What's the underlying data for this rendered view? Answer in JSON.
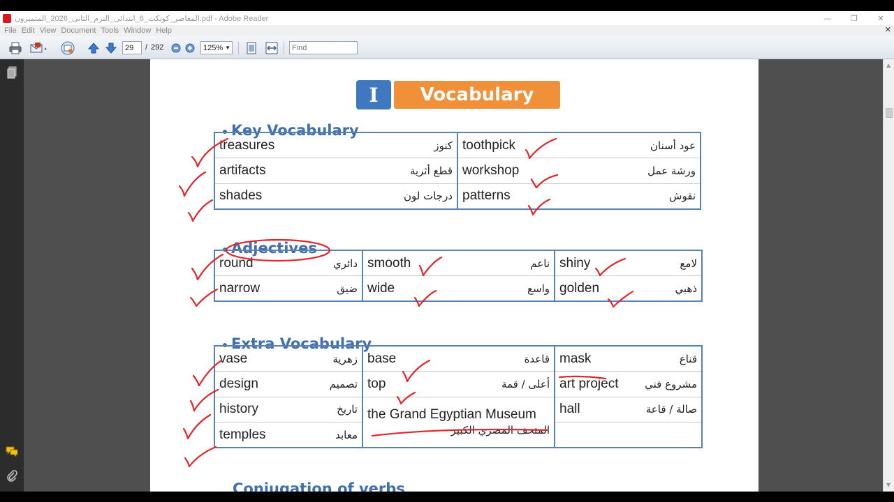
{
  "window": {
    "title": "المعاصر_كونكت_6_ابتدائى_الترم_الثانى_2026_المتميزون.pdf - Adobe Reader",
    "controls": {
      "minimize": "—",
      "maximize": "❐",
      "close": "✕"
    }
  },
  "menu": [
    "File",
    "Edit",
    "View",
    "Document",
    "Tools",
    "Window",
    "Help"
  ],
  "menu_close": "✕",
  "toolbar": {
    "current_page": "29",
    "page_separator": "/",
    "total_pages": "292",
    "zoom": "125%",
    "find_placeholder": "Find"
  },
  "page": {
    "section_number": "I",
    "section_title": "Vocabulary",
    "key_vocabulary": {
      "title": "Key Vocabulary",
      "rows": [
        [
          {
            "en": "treasures",
            "ar": "كنوز"
          },
          {
            "en": "toothpick",
            "ar": "عود أسنان"
          }
        ],
        [
          {
            "en": "artifacts",
            "ar": "قطع أثرية"
          },
          {
            "en": "workshop",
            "ar": "ورشة عمل"
          }
        ],
        [
          {
            "en": "shades",
            "ar": "درجات لون"
          },
          {
            "en": "patterns",
            "ar": "نقوش"
          }
        ]
      ]
    },
    "adjectives": {
      "title": "Adjectives",
      "rows": [
        [
          {
            "en": "round",
            "ar": "دائري"
          },
          {
            "en": "smooth",
            "ar": "ناعم"
          },
          {
            "en": "shiny",
            "ar": "لامع"
          }
        ],
        [
          {
            "en": "narrow",
            "ar": "ضيق"
          },
          {
            "en": "wide",
            "ar": "واسع"
          },
          {
            "en": "golden",
            "ar": "ذهبي"
          }
        ]
      ]
    },
    "extra_vocabulary": {
      "title": "Extra Vocabulary",
      "rows": [
        [
          {
            "en": "vase",
            "ar": "زهرية"
          },
          {
            "en": "base",
            "ar": "قاعدة"
          },
          {
            "en": "mask",
            "ar": "قناع"
          }
        ],
        [
          {
            "en": "design",
            "ar": "تصميم"
          },
          {
            "en": "top",
            "ar": "أعلى / قمة"
          },
          {
            "en": "art project",
            "ar": "مشروع فني"
          }
        ],
        [
          {
            "en": "history",
            "ar": "تاريخ"
          },
          {
            "en": "the Grand Egyptian Museum",
            "ar": "المتحف المصري الكبير"
          },
          {
            "en": "hall",
            "ar": "صالة / قاعة"
          }
        ],
        [
          {
            "en": "temples",
            "ar": "معابد"
          },
          null,
          {
            "en": "",
            "ar": ""
          }
        ]
      ]
    },
    "next_section_title": "Conjugation of verbs"
  },
  "colors": {
    "section_blue": "#3f6fad",
    "badge_blue": "#3f78bf",
    "badge_orange": "#f0913a",
    "table_border": "#5b7fb0",
    "pen_red": "#e0262c"
  },
  "icons": [
    "pdf-app-icon",
    "print-icon",
    "email-icon",
    "collaborate-icon",
    "arrow-up-icon",
    "arrow-down-icon",
    "zoom-out-icon",
    "zoom-in-icon",
    "fit-page-icon",
    "fit-width-icon",
    "pages-icon",
    "comment-icon",
    "attachment-icon"
  ]
}
